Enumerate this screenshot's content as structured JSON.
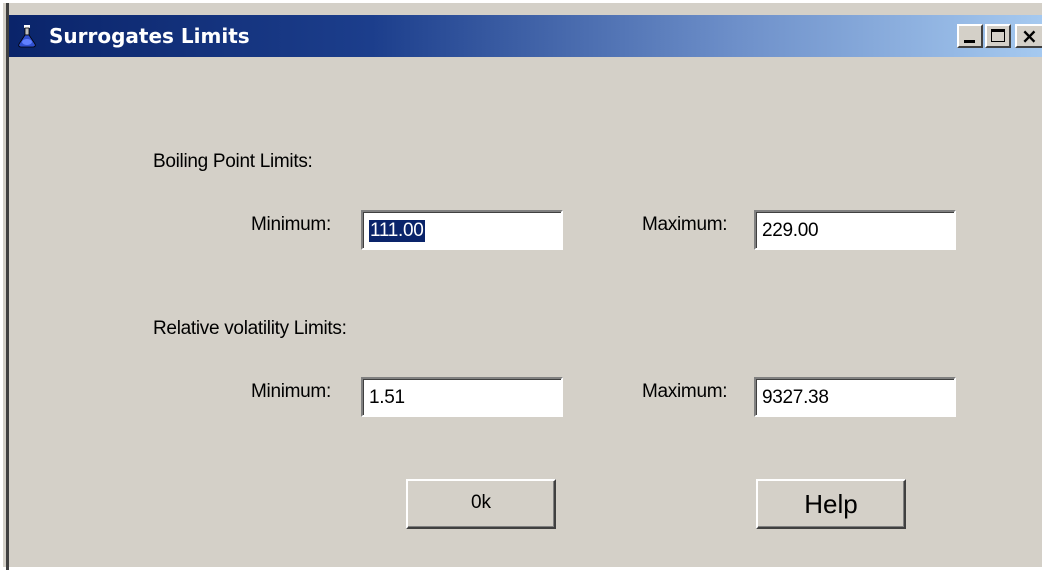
{
  "window": {
    "title": "Surrogates Limits",
    "icon": "flask-icon",
    "controls": {
      "minimize": "minimize-icon",
      "maximize": "maximize-icon",
      "close": "close-icon"
    }
  },
  "boiling_point": {
    "heading": "Boiling Point Limits:",
    "min_label": "Minimum:",
    "min_value": "111.00",
    "max_label": "Maximum:",
    "max_value": "229.00"
  },
  "relative_volatility": {
    "heading": "Relative volatility Limits:",
    "min_label": "Minimum:",
    "min_value": "1.51",
    "max_label": "Maximum:",
    "max_value": "9327.38"
  },
  "buttons": {
    "ok": "0k",
    "help": "Help"
  },
  "colors": {
    "dialog_bg": "#d4d0c8",
    "titlebar_start": "#0a246a",
    "titlebar_end": "#a6caf0",
    "selection": "#0a246a"
  }
}
